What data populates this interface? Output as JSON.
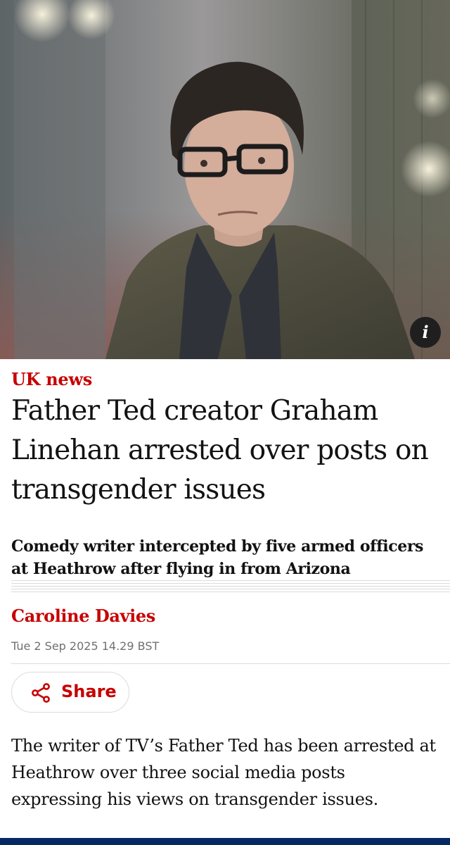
{
  "hero": {
    "photo_subject": "portrait-photo",
    "info_label": "i"
  },
  "article": {
    "kicker": "UK news",
    "headline": "Father Ted creator Graham Linehan arrested over posts on transgender issues",
    "standfirst": "Comedy writer intercepted by five armed officers at Heathrow after flying in from Arizona",
    "byline": "Caroline Davies",
    "dateline": "Tue 2 Sep 2025 14.29 BST",
    "share_label": "Share",
    "body": "The writer of TV’s Father Ted has been arrested at Heathrow over three social media posts expressing his views on transgender issues."
  },
  "colors": {
    "accent_red": "#c70000",
    "brand_navy": "#052962",
    "text": "#121212",
    "muted": "#707070"
  },
  "icons": {
    "info": "info-icon",
    "share": "share-icon"
  }
}
